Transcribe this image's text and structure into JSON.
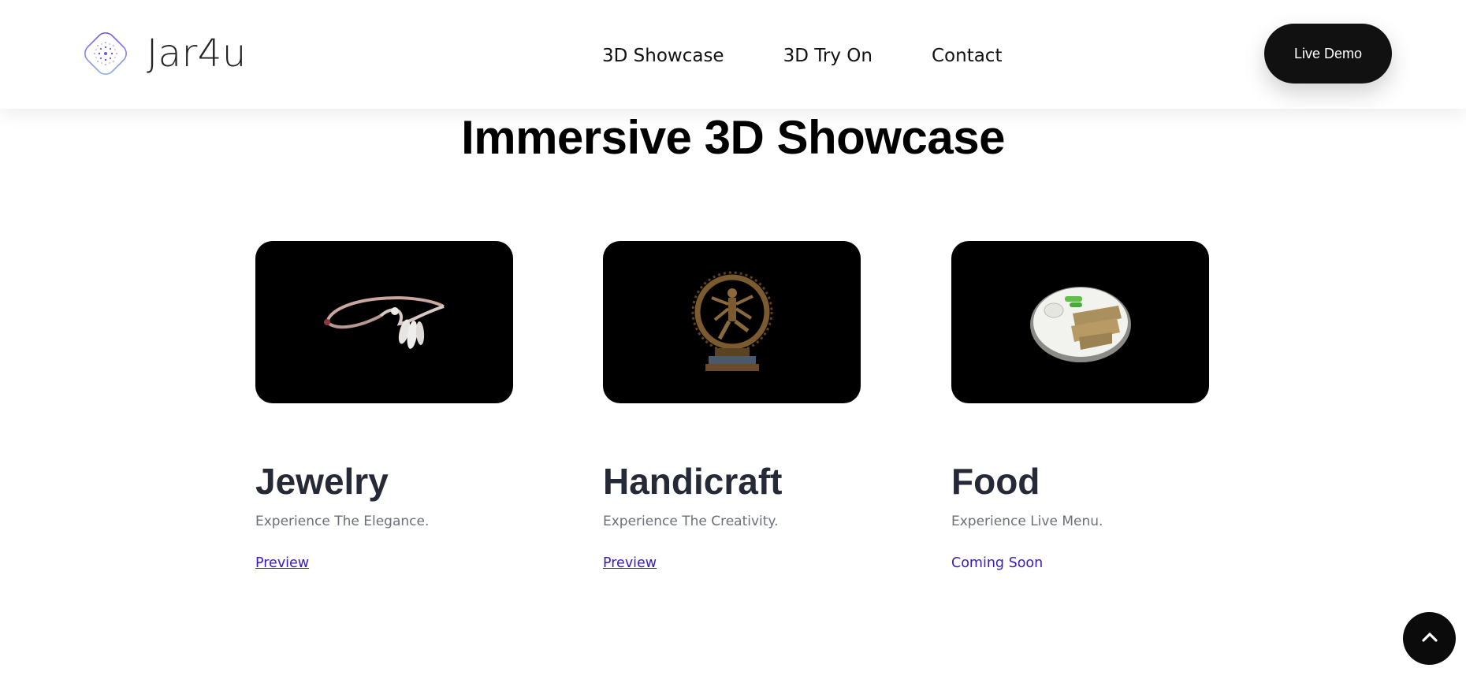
{
  "brand": {
    "name": "Jar4u",
    "logo_icon": "dotted-diamond-logo-icon"
  },
  "nav": {
    "items": [
      "3D Showcase",
      "3D Try On",
      "Contact"
    ]
  },
  "header": {
    "cta_label": "Live Demo"
  },
  "main": {
    "title": "Immersive 3D Showcase",
    "cards": [
      {
        "title": "Jewelry",
        "description": "Experience The Elegance.",
        "link": "Preview",
        "image_icon": "bracelet-image"
      },
      {
        "title": "Handicraft",
        "description": "Experience The Creativity.",
        "link": "Preview",
        "image_icon": "nataraja-statue-image"
      },
      {
        "title": "Food",
        "description": "Experience Live Menu.",
        "link": "Coming Soon",
        "image_icon": "food-plate-image"
      }
    ]
  },
  "scroll_top": {
    "icon": "chevron-up-icon"
  },
  "colors": {
    "accent_link": "#3a1bb8",
    "button_bg": "#111111",
    "card_bg": "#000000"
  }
}
